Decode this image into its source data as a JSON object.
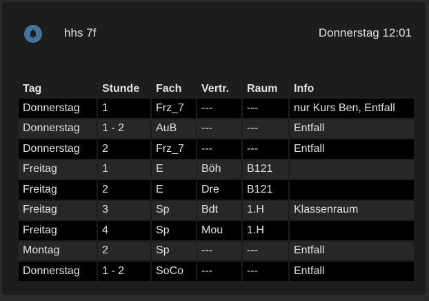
{
  "header": {
    "title": "hhs 7f",
    "datetime": "Donnerstag 12:01",
    "icon": "bell-icon",
    "icon_color": "#44739e"
  },
  "table": {
    "columns": [
      "Tag",
      "Stunde",
      "Fach",
      "Vertr.",
      "Raum",
      "Info"
    ],
    "rows": [
      [
        "Donnerstag",
        "1",
        "Frz_7",
        "---",
        "---",
        "nur Kurs Ben, Entfall"
      ],
      [
        "Donnerstag",
        "1 - 2",
        "AuB",
        "---",
        "---",
        "Entfall"
      ],
      [
        "Donnerstag",
        "2",
        "Frz_7",
        "---",
        "---",
        "Entfall"
      ],
      [
        "Freitag",
        "1",
        "E",
        "Böh",
        "B121",
        ""
      ],
      [
        "Freitag",
        "2",
        "E",
        "Dre",
        "B121",
        ""
      ],
      [
        "Freitag",
        "3",
        "Sp",
        "Bdt",
        "1.H",
        "Klassenraum"
      ],
      [
        "Freitag",
        "4",
        "Sp",
        "Mou",
        "1.H",
        ""
      ],
      [
        "Montag",
        "2",
        "Sp",
        "---",
        "---",
        "Entfall"
      ],
      [
        "Donnerstag",
        "1 - 2",
        "SoCo",
        "---",
        "---",
        "Entfall"
      ]
    ]
  }
}
